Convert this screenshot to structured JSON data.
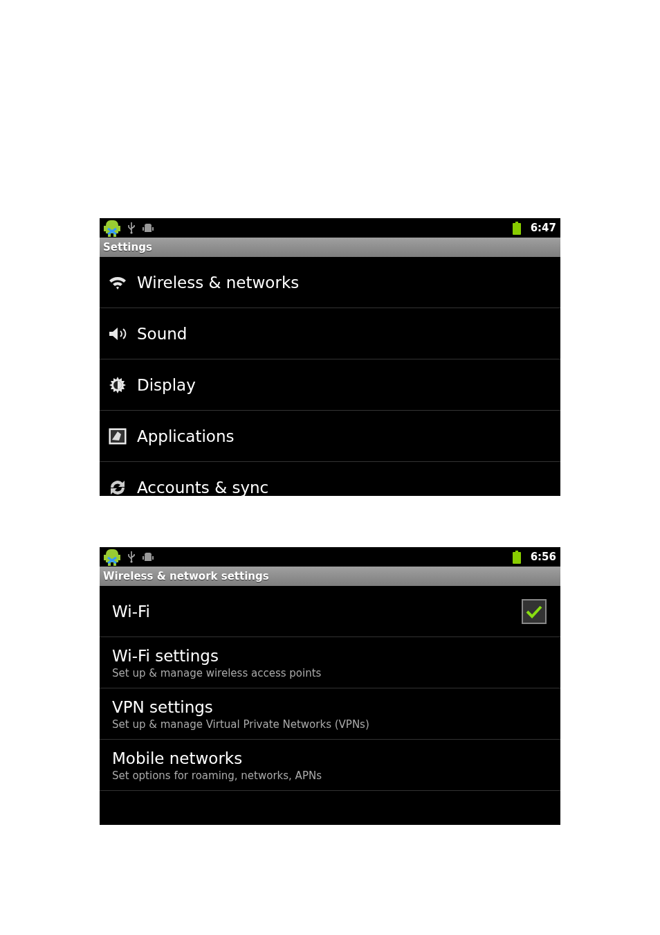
{
  "screens": [
    {
      "status_bar": {
        "time": "6:47"
      },
      "title": "Settings",
      "items": [
        {
          "kind": "icon",
          "label": "Wireless & networks"
        },
        {
          "kind": "icon",
          "label": "Sound"
        },
        {
          "kind": "icon",
          "label": "Display"
        },
        {
          "kind": "icon",
          "label": "Applications"
        },
        {
          "kind": "icon",
          "label": "Accounts & sync"
        }
      ]
    },
    {
      "status_bar": {
        "time": "6:56"
      },
      "title": "Wireless & network settings",
      "items": [
        {
          "kind": "checkbox",
          "label": "Wi-Fi",
          "checked": true
        },
        {
          "kind": "summary",
          "label": "Wi-Fi settings",
          "summary": "Set up & manage wireless access points"
        },
        {
          "kind": "summary",
          "label": "VPN settings",
          "summary": "Set up & manage Virtual Private Networks (VPNs)"
        },
        {
          "kind": "summary",
          "label": "Mobile networks",
          "summary": "Set options for roaming, networks, APNs"
        }
      ]
    }
  ]
}
